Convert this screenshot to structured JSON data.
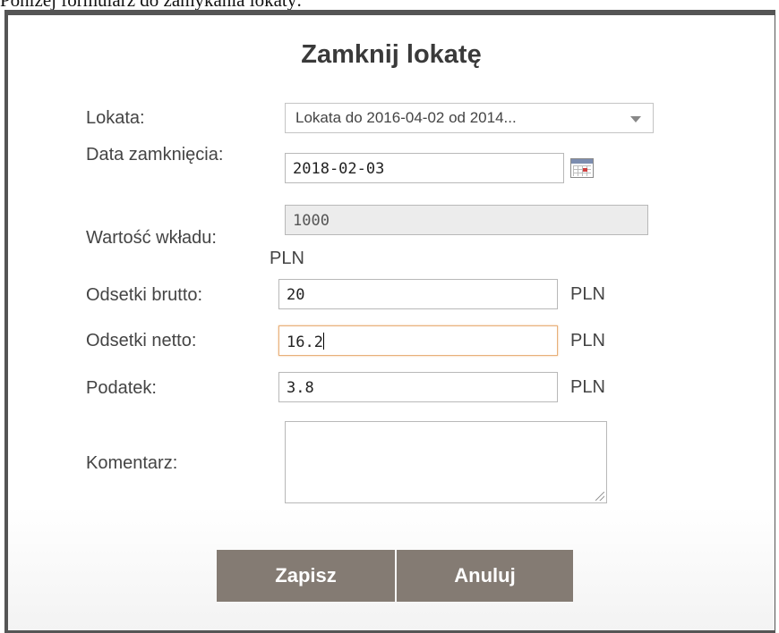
{
  "page": {
    "intro_text": "Poniżej formularz do zamykania lokaty:"
  },
  "modal": {
    "title": "Zamknij lokatę"
  },
  "form": {
    "lokata": {
      "label": "Lokata:",
      "selected": "Lokata do 2016-04-02 od 2014..."
    },
    "data_zamkniecia": {
      "label": "Data zamknięcia:",
      "value": "2018-02-03",
      "icon": "calendar-icon"
    },
    "wartosc_wkladu": {
      "label": "Wartość wkładu:",
      "value": "1000",
      "unit": "PLN"
    },
    "odsetki_brutto": {
      "label": "Odsetki brutto:",
      "value": "20",
      "unit": "PLN"
    },
    "odsetki_netto": {
      "label": "Odsetki netto:",
      "value": "16.2",
      "unit": "PLN"
    },
    "podatek": {
      "label": "Podatek:",
      "value": "3.8",
      "unit": "PLN"
    },
    "komentarz": {
      "label": "Komentarz:",
      "value": ""
    }
  },
  "buttons": {
    "save_label": "Zapisz",
    "cancel_label": "Anuluj"
  }
}
